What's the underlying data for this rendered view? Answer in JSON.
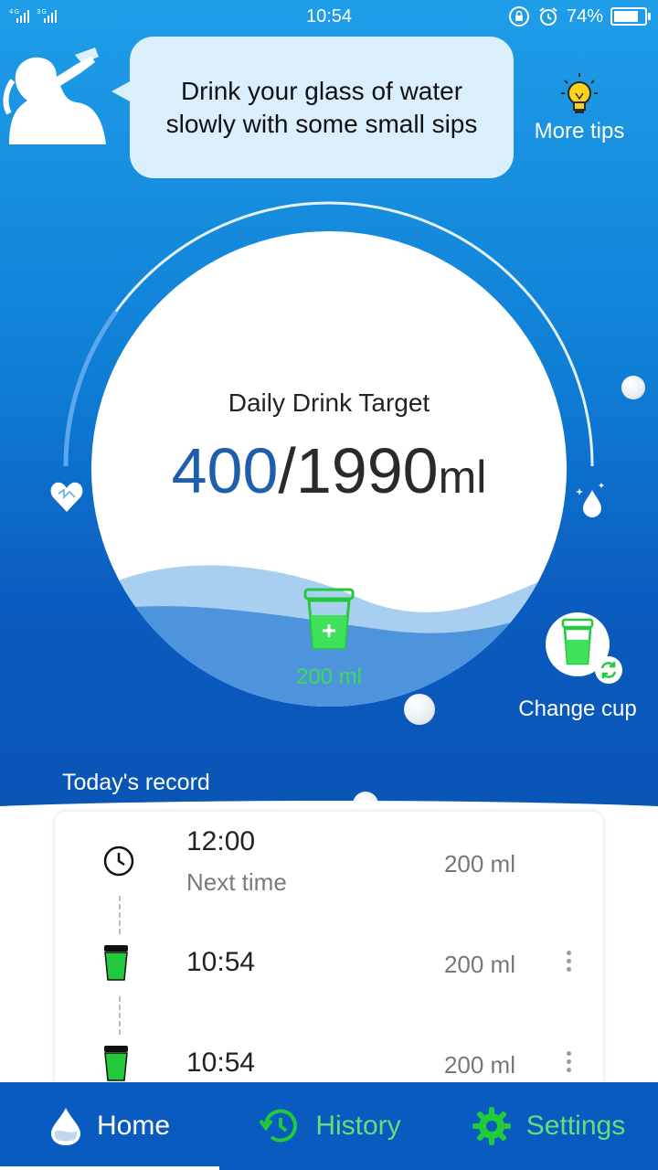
{
  "status_bar": {
    "signal_text": "4G 3G",
    "time": "10:54",
    "battery": "74%",
    "battery_level": 0.74
  },
  "tip": {
    "line1": "Drink your glass of water",
    "line2": "slowly with some small sips",
    "more_tips_label": "More tips"
  },
  "target": {
    "label": "Daily Drink Target",
    "current": "400",
    "separator": "/",
    "goal": "1990",
    "unit": "ml",
    "progress": 0.2
  },
  "add_cup": {
    "amount": "200 ml"
  },
  "change_cup_label": "Change cup",
  "record": {
    "title": "Today's record",
    "next": {
      "time": "12:00",
      "label": "Next time",
      "amount": "200 ml"
    },
    "entries": [
      {
        "time": "10:54",
        "amount": "200 ml"
      },
      {
        "time": "10:54",
        "amount": "200 ml"
      }
    ]
  },
  "tabs": [
    {
      "label": "Home",
      "icon": "water-drop-icon",
      "active": true
    },
    {
      "label": "History",
      "icon": "history-icon",
      "active": false
    },
    {
      "label": "Settings",
      "icon": "gear-icon",
      "active": false
    }
  ],
  "colors": {
    "primary_blue": "#0a5bbf",
    "accent_green": "#5fe07a",
    "cup_green": "#22c93a",
    "current_amount": "#1e5eaa"
  }
}
